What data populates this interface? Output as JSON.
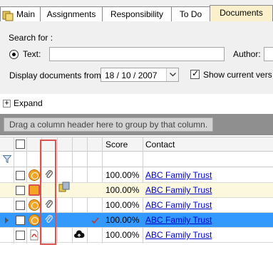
{
  "tabs": [
    {
      "label": "Main",
      "active": false
    },
    {
      "label": "Assignments",
      "active": false
    },
    {
      "label": "Responsibility",
      "active": false
    },
    {
      "label": "To Do",
      "active": false
    },
    {
      "label": "Documents",
      "active": true
    }
  ],
  "search": {
    "section_label": "Search for :",
    "text_label": "Text:",
    "text_value": "",
    "author_label": "Author:",
    "author_value": "",
    "display_from_label": "Display documents from:",
    "display_from_value": "18 / 10 / 2007",
    "show_current_label": "Show current vers"
  },
  "expand_label": "Expand",
  "grid": {
    "group_hint": "Drag a column header here to group by that column.",
    "columns": {
      "score": "Score",
      "contact": "Contact"
    },
    "rows": [
      {
        "score": "100.00%",
        "contact": "ABC Family Trust",
        "style": "normal",
        "icons": [
          "clock-icon",
          "paperclip-icon"
        ]
      },
      {
        "score": "100.00%",
        "contact": "ABC Family Trust",
        "style": "alt",
        "icons": [
          "clock-red-icon",
          "note-icon"
        ]
      },
      {
        "score": "100.00%",
        "contact": "ABC Family Trust",
        "style": "normal",
        "icons": [
          "clock-icon",
          "paperclip-icon"
        ]
      },
      {
        "score": "100.00%",
        "contact": "ABC Family Trust",
        "style": "selected",
        "icons": [
          "clock-icon",
          "paperclip-icon",
          "checkmark-icon"
        ]
      },
      {
        "score": "100.00%",
        "contact": "ABC Family Trust",
        "style": "normal",
        "icons": [
          "pdf-icon",
          "cloud-upload-icon"
        ]
      }
    ]
  },
  "colors": {
    "highlight": "#d9534f",
    "selected_row": "#3399ff",
    "alt_row": "#fbf8de",
    "link": "#0000cc"
  }
}
